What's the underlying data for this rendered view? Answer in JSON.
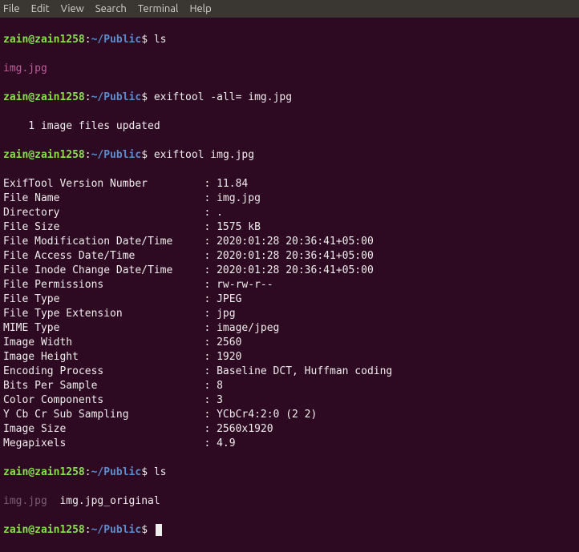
{
  "menubar": {
    "items": [
      "File",
      "Edit",
      "View",
      "Search",
      "Terminal",
      "Help"
    ]
  },
  "prompt": {
    "userhost": "zain@zain1258",
    "path": "~/Public",
    "dollar": "$"
  },
  "cmds": {
    "ls1": "ls",
    "ex1": "exiftool -all= img.jpg",
    "ex2": "exiftool img.jpg",
    "ls2": "ls"
  },
  "outputs": {
    "img1": "img.jpg",
    "updated": "    1 image files updated",
    "imgdim": "img.jpg",
    "original": "  img.jpg_original"
  },
  "fields": [
    {
      "k": "ExifTool Version Number",
      "v": "11.84"
    },
    {
      "k": "File Name",
      "v": "img.jpg"
    },
    {
      "k": "Directory",
      "v": "."
    },
    {
      "k": "File Size",
      "v": "1575 kB"
    },
    {
      "k": "File Modification Date/Time",
      "v": "2020:01:28 20:36:41+05:00"
    },
    {
      "k": "File Access Date/Time",
      "v": "2020:01:28 20:36:41+05:00"
    },
    {
      "k": "File Inode Change Date/Time",
      "v": "2020:01:28 20:36:41+05:00"
    },
    {
      "k": "File Permissions",
      "v": "rw-rw-r--"
    },
    {
      "k": "File Type",
      "v": "JPEG"
    },
    {
      "k": "File Type Extension",
      "v": "jpg"
    },
    {
      "k": "MIME Type",
      "v": "image/jpeg"
    },
    {
      "k": "Image Width",
      "v": "2560"
    },
    {
      "k": "Image Height",
      "v": "1920"
    },
    {
      "k": "Encoding Process",
      "v": "Baseline DCT, Huffman coding"
    },
    {
      "k": "Bits Per Sample",
      "v": "8"
    },
    {
      "k": "Color Components",
      "v": "3"
    },
    {
      "k": "Y Cb Cr Sub Sampling",
      "v": "YCbCr4:2:0 (2 2)"
    },
    {
      "k": "Image Size",
      "v": "2560x1920"
    },
    {
      "k": "Megapixels",
      "v": "4.9"
    }
  ]
}
